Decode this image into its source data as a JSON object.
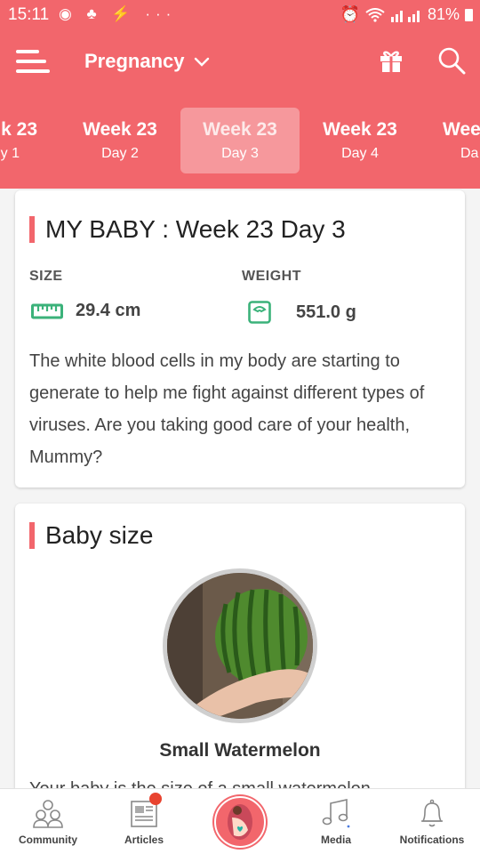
{
  "status_bar": {
    "time": "15:11",
    "left_icons": "◉ ♣ ⚡ ···",
    "battery": "81%"
  },
  "app_bar": {
    "title": "Pregnancy",
    "accent_color": "#f2666c"
  },
  "week_tabs": [
    {
      "week": "k 23",
      "day": "y 1"
    },
    {
      "week": "Week 23",
      "day": "Day 2"
    },
    {
      "week": "Week 23",
      "day": "Day 3",
      "active": true
    },
    {
      "week": "Week 23",
      "day": "Day 4"
    },
    {
      "week": "Wee",
      "day": "Da"
    }
  ],
  "baby_card": {
    "title": "MY BABY : Week 23 Day 3",
    "size_label": "SIZE",
    "size_value": "29.4 cm",
    "weight_label": "WEIGHT",
    "weight_value": "551.0 g",
    "description": "The white blood cells in my body are starting to generate to help me fight against different types of viruses. Are you taking good care of your health, Mummy?"
  },
  "size_card": {
    "title": "Baby size",
    "fruit_name": "Small Watermelon",
    "partial_text": "Your baby is the size of a small watermelon"
  },
  "bottom_nav": [
    {
      "label": "Community",
      "icon": "community-icon"
    },
    {
      "label": "Articles",
      "icon": "articles-icon"
    },
    {
      "label": "",
      "icon": "pregnancy-home-icon"
    },
    {
      "label": "Media",
      "icon": "music-note-icon"
    },
    {
      "label": "Notifications",
      "icon": "bell-icon"
    }
  ]
}
